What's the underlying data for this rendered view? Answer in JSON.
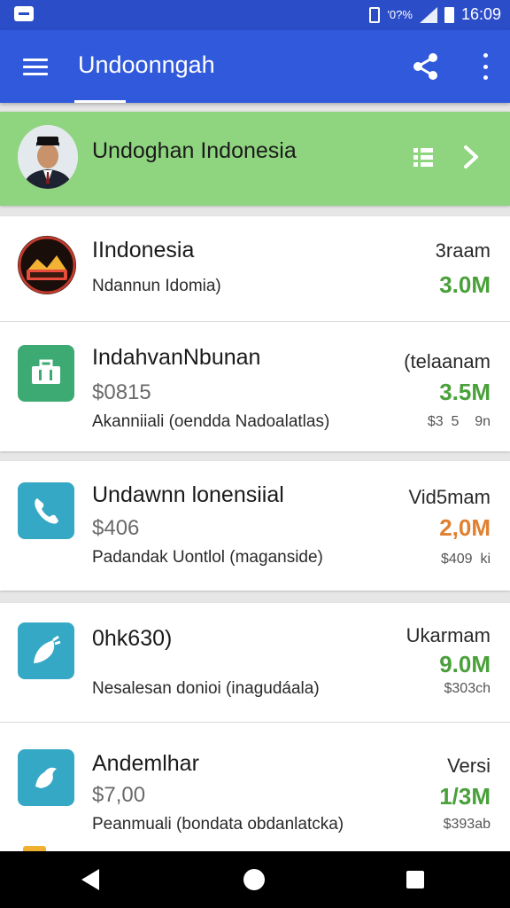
{
  "status_bar": {
    "data_text": "'0?%",
    "time": "16:09"
  },
  "app_bar": {
    "title": "Undoonngah"
  },
  "banner": {
    "title": "Undoghan Indonesia"
  },
  "items": [
    {
      "name": "IIndonesia",
      "desc": "Ndannun Idomia)",
      "label": "3raam",
      "value": "3.0M",
      "value_color": "#4aa03a",
      "icon": "indonesia-logo-icon"
    },
    {
      "name": "IndahvanNbunan",
      "price": "$0815",
      "desc": "Akanniiali (oendda Nadoalatlas)",
      "label": "(telaanam",
      "value": "3.5M",
      "value_color": "#4aa03a",
      "sub": "$3  5    9n",
      "icon": "briefcase-icon",
      "icon_color": "#3daa74"
    },
    {
      "name": "Undawnn lonensiial",
      "price": "$406",
      "desc": "Padandak  Uontlol (maganside)",
      "label": "Vid5mam",
      "value": "2,0M",
      "value_color": "#e08030",
      "sub": "$409  ki",
      "icon": "phone-icon",
      "icon_color": "#35a8c5"
    },
    {
      "name": "0hk630)",
      "desc": "Nesalesan donioi (inagudáala)",
      "label": "Ukarmam",
      "value": "9.0M",
      "value_color": "#4aa03a",
      "sub": "$303ch",
      "icon": "leaf-icon",
      "icon_color": "#35a8c5"
    },
    {
      "name": "Andemlhar",
      "price": "$7,00",
      "desc": "Peanmuali (bondata obdanlatcka)",
      "label": "Versi",
      "value": "1/3M",
      "value_color": "#4aa03a",
      "sub": "$393ab",
      "icon": "bird-icon",
      "icon_color": "#35a8c5"
    }
  ]
}
